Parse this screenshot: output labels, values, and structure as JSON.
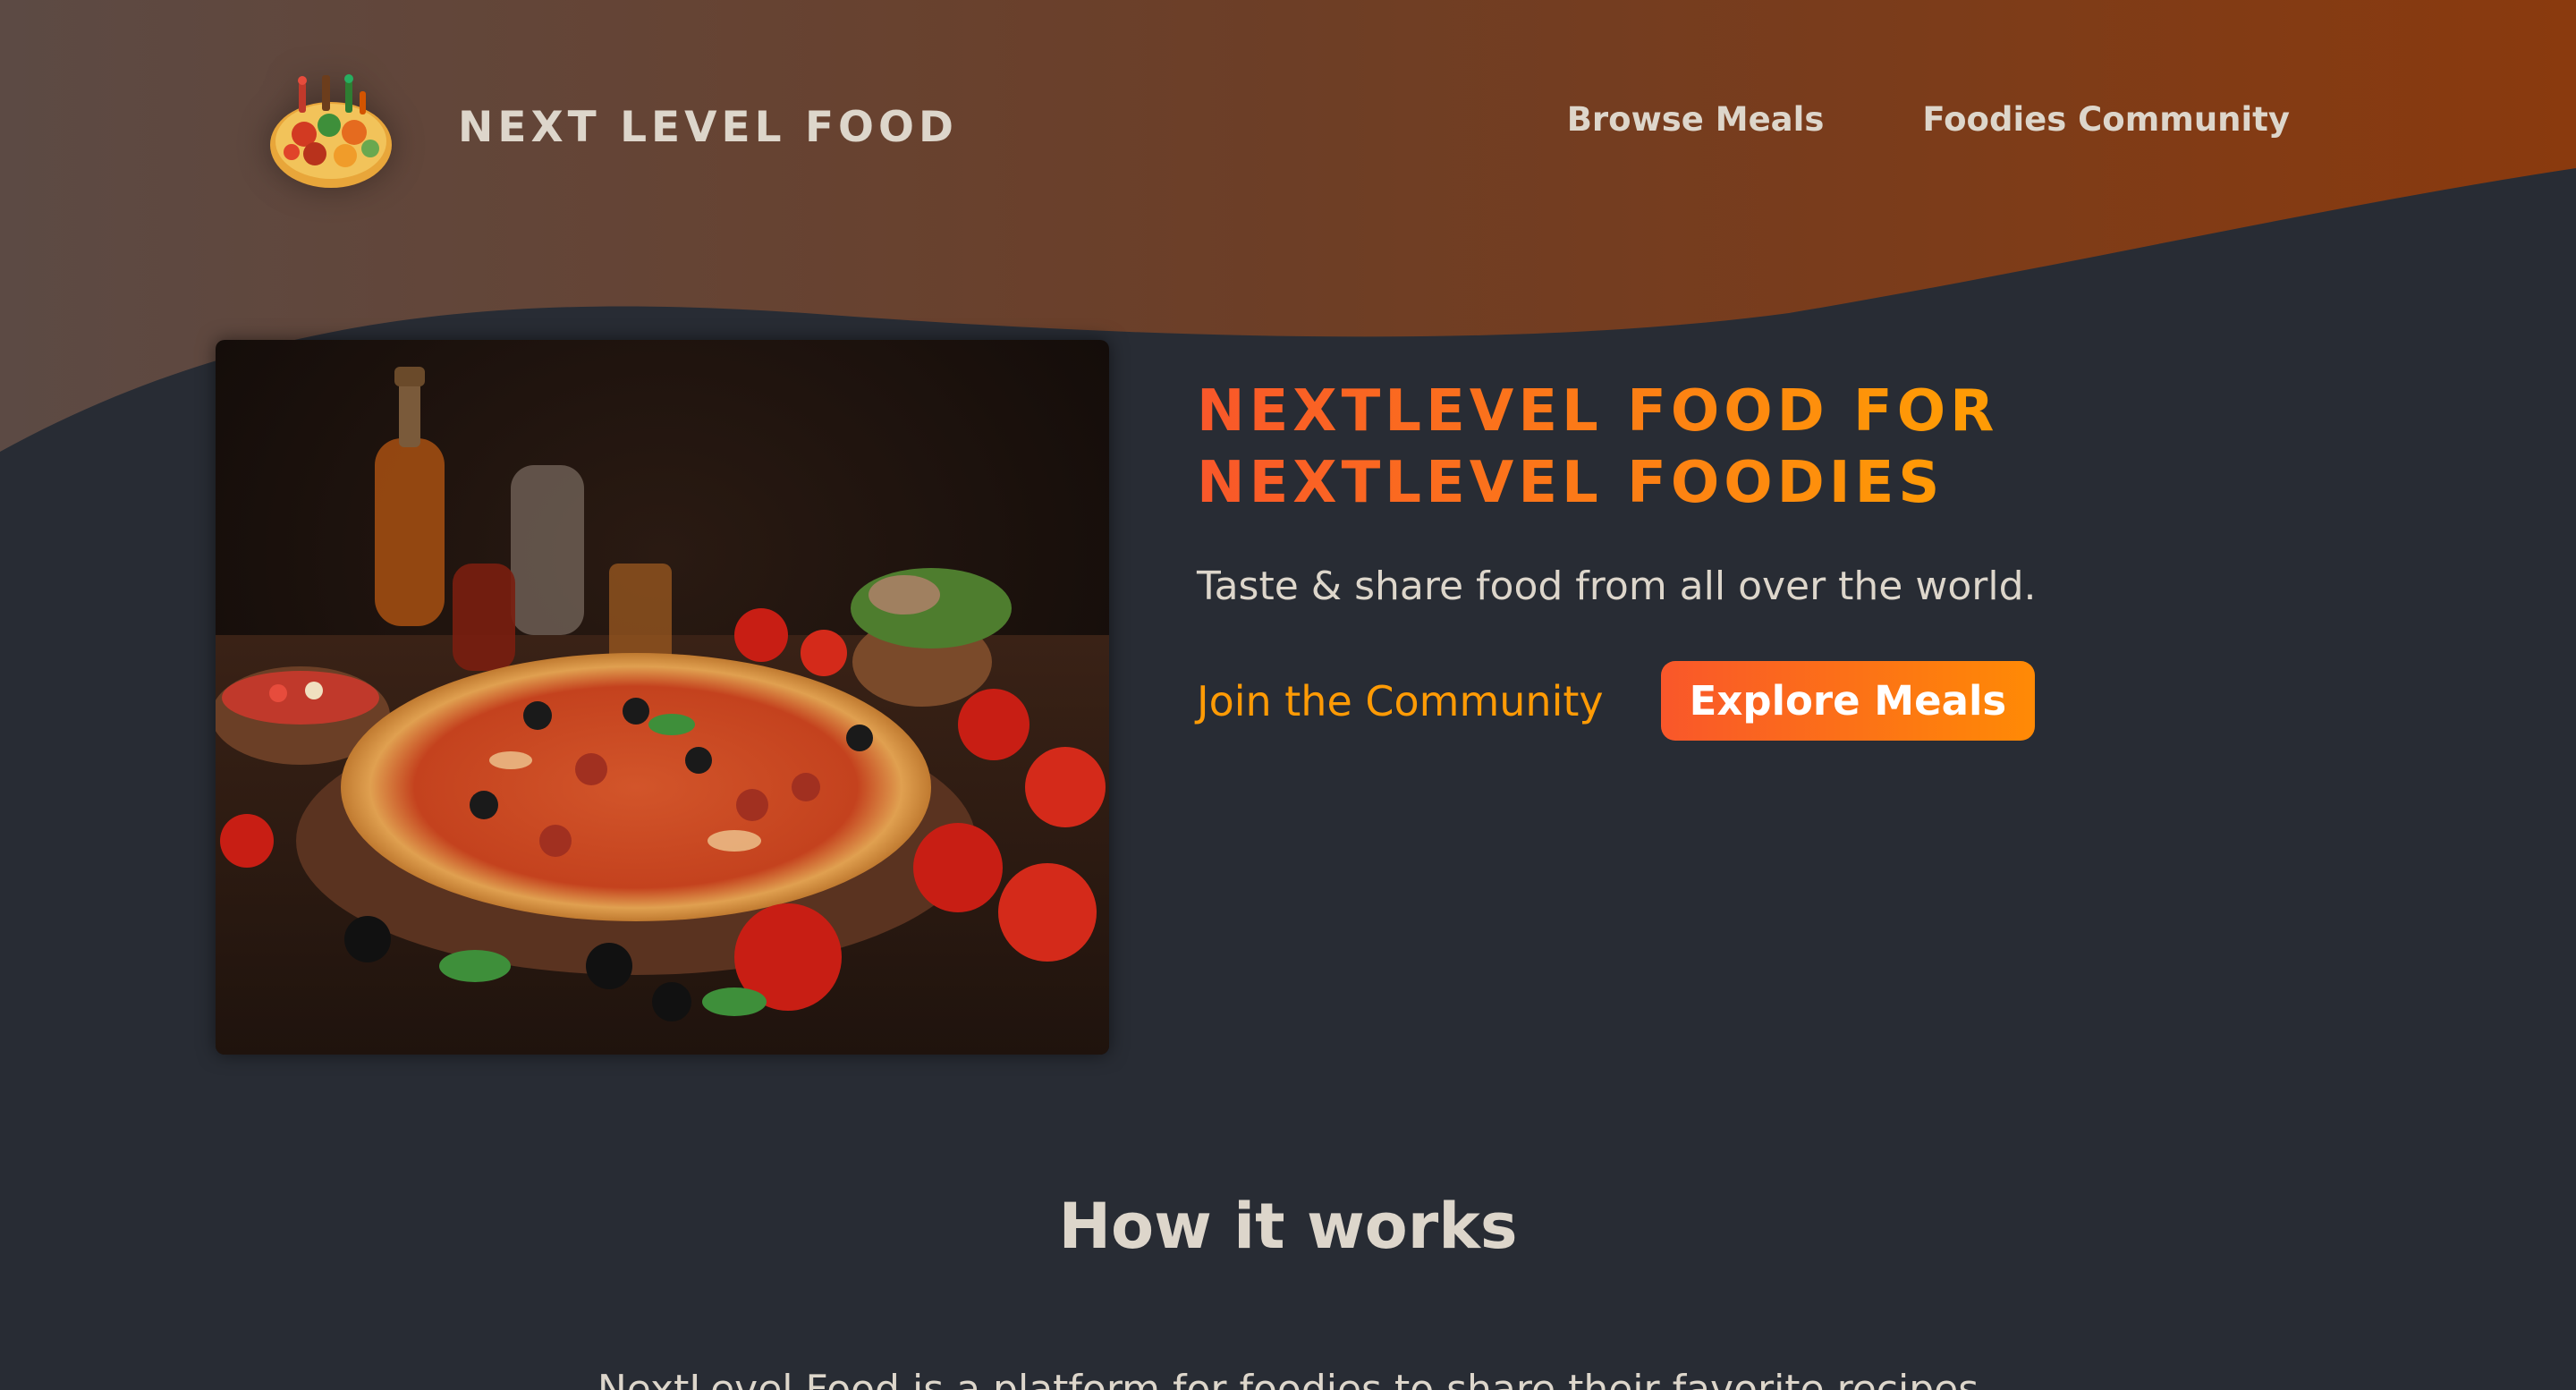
{
  "header": {
    "logo_text": "NEXT LEVEL FOOD",
    "logo_icon": "food-platter-icon",
    "nav": [
      {
        "label": "Browse Meals"
      },
      {
        "label": "Foodies Community"
      }
    ]
  },
  "hero": {
    "title_line1": "NEXTLEVEL FOOD FOR",
    "title_line2": "NEXTLEVEL FOODIES",
    "subtitle": "Taste & share food from all over the world.",
    "join_link": "Join the Community",
    "explore_button": "Explore Meals",
    "image_icon": "pizza-image"
  },
  "how_it_works": {
    "title": "How it works",
    "text": "NextLevel Food is a platform for foodies to share their favorite recipes"
  },
  "colors": {
    "background": "#282c34",
    "header_gradient_start": "#5c4a44",
    "header_gradient_end": "#8a3a0e",
    "accent_start": "#f9572a",
    "accent_end": "#ff9b05",
    "text_light": "#ddd6cb"
  }
}
